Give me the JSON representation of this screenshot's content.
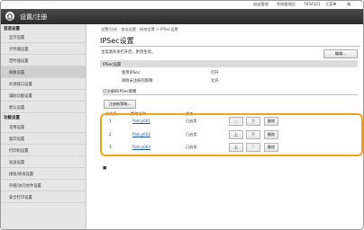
{
  "topbar": {
    "items": [
      "退出管理",
      "系统管理员",
      "7654321",
      "主菜单",
      "端"
    ]
  },
  "header": {
    "title": "设置/注册"
  },
  "sidebar": {
    "section1": "首选设置",
    "items1": [
      "显示设置",
      "计时器设置",
      "定时器设置",
      "网络设置",
      "外部接口设置",
      "辅助功能设置",
      "默认设置"
    ],
    "section2": "功能设置",
    "items2": [
      "常用设置",
      "复印设置",
      "打印机设置",
      "发送设置",
      "接收/转发设置",
      "存储/访问文件设置",
      "安全打印设置"
    ]
  },
  "main": {
    "breadcrumb": "设置/注册 : 首选设置 : 网络设置 > IPSec设置",
    "title": "IPSec设置",
    "note": "主电源开关打开后，更改生效。",
    "edit_label": "编辑...",
    "band_label": "IPSec设置",
    "use_ipsec_label": "使用IPSec:",
    "use_ipsec_value": "打开",
    "policy_label": "接收未注册的策略:",
    "policy_value": "允许",
    "registered_head": "已注册的IPSec策略",
    "register_new_label": "注册新策略...",
    "columns": [
      "优先级",
      "策略名称",
      "状态"
    ],
    "rows": [
      {
        "priority": "1",
        "name": "Policy001",
        "status": "已启用",
        "up": "上",
        "down": "下",
        "delete": "删除"
      },
      {
        "priority": "2",
        "name": "Policy002",
        "status": "已启用",
        "up": "上",
        "down": "下",
        "delete": "删除"
      },
      {
        "priority": "3",
        "name": "Policy003",
        "status": "已启用",
        "up": "上",
        "down": "下",
        "delete": "删除"
      }
    ],
    "footer_symbol": "■"
  },
  "colors": {
    "highlight": "#f3a21b",
    "link": "#1a55a8",
    "header": "#2c2c2c"
  },
  "icons": [
    "home-icon",
    "logo-icon"
  ]
}
